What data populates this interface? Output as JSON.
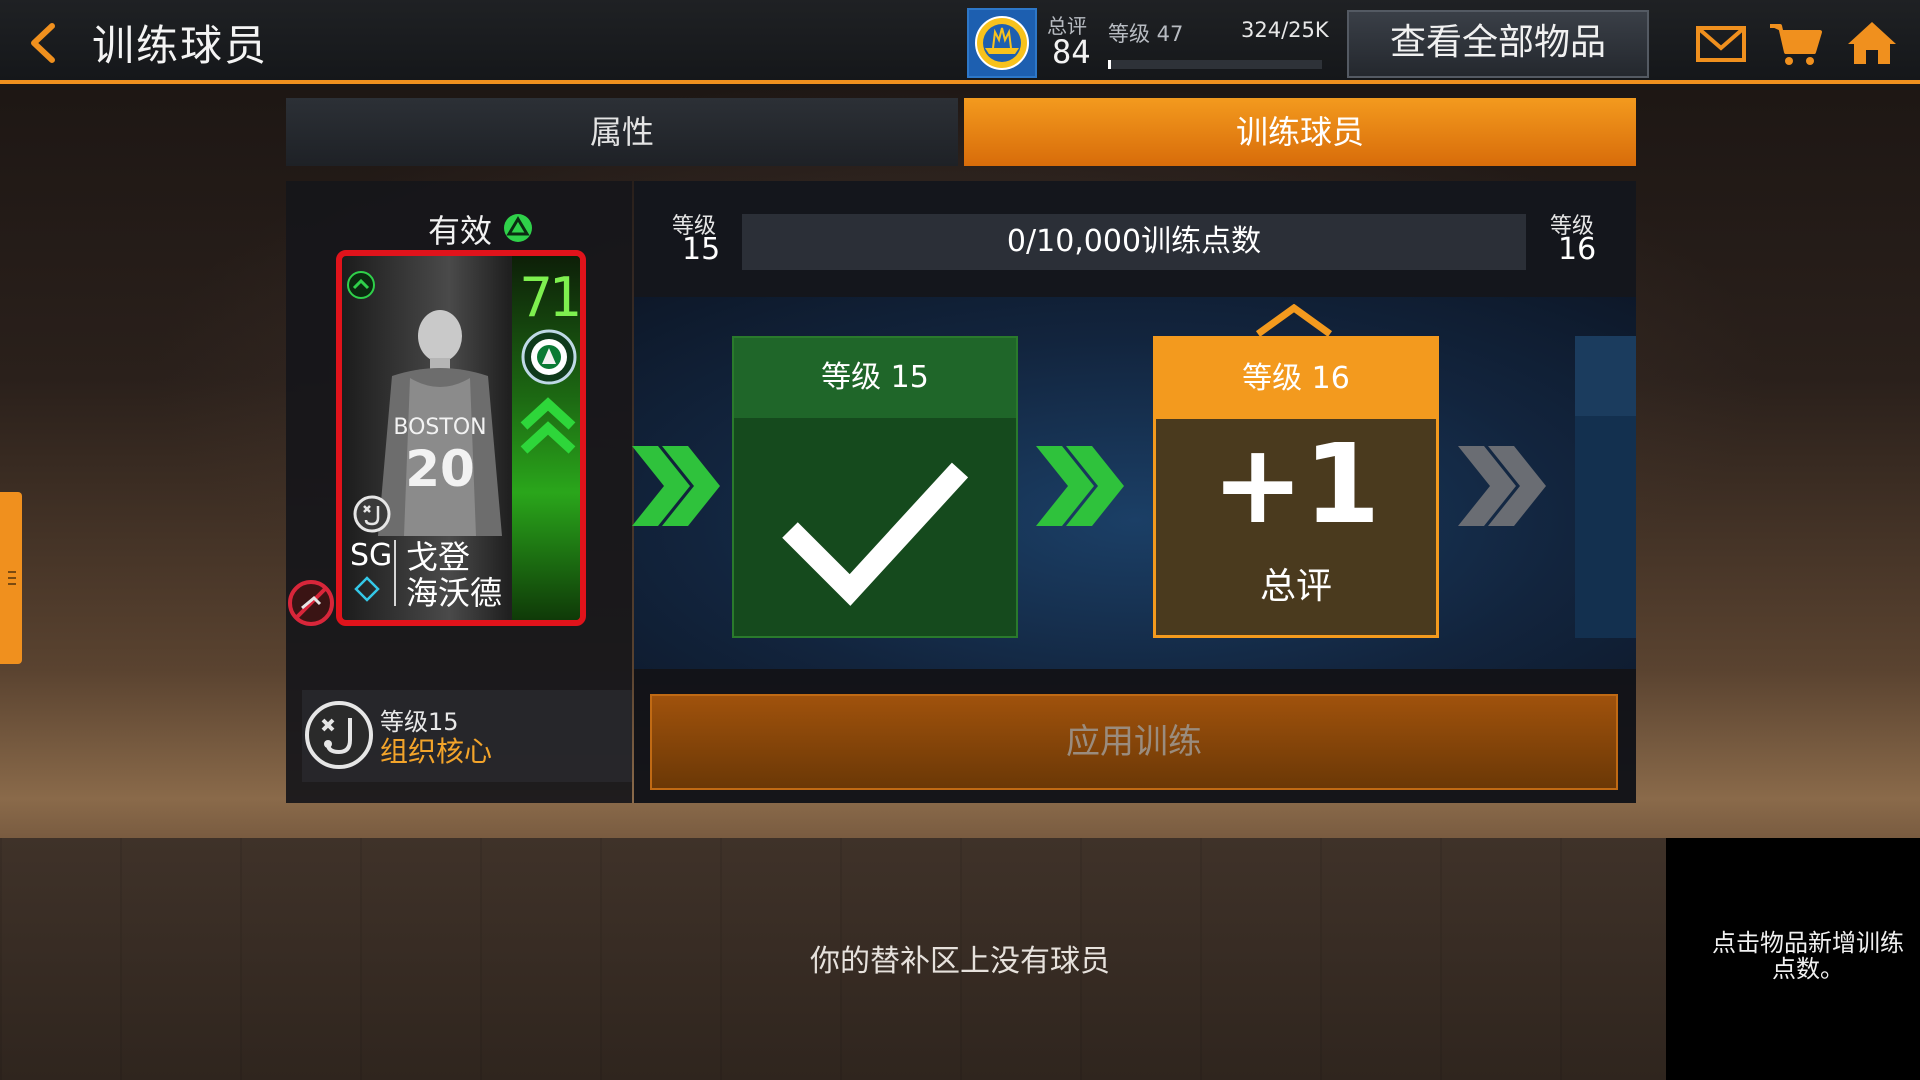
{
  "header": {
    "title": "训练球员",
    "overall_label": "总评",
    "overall_value": "84",
    "level_label": "等级 47",
    "xp_text": "324/25K",
    "xp_progress": 0.013,
    "view_all_label": "查看全部物品",
    "icons": [
      "back-chevron-icon",
      "team-logo-icon",
      "mail-icon",
      "cart-icon",
      "home-icon"
    ]
  },
  "tabs": [
    {
      "label": "属性",
      "active": false
    },
    {
      "label": "训练球员",
      "active": true
    }
  ],
  "player": {
    "status_label": "有效",
    "rating": "71",
    "position": "SG",
    "name_line1": "戈登",
    "name_line2": "海沃德",
    "jersey_number": "20",
    "jersey_team": "BOSTON"
  },
  "skill": {
    "level": "等级15",
    "name": "组织核心"
  },
  "progress": {
    "from_label": "等级",
    "from_value": "15",
    "to_label": "等级",
    "to_value": "16",
    "text": "0/10,000训练点数",
    "fraction": 0
  },
  "rewards": [
    {
      "title": "等级 15",
      "state": "completed"
    },
    {
      "title": "等级 16",
      "value": "+1",
      "label": "总评",
      "state": "current"
    }
  ],
  "apply_button_label": "应用训练",
  "bench": {
    "empty_message": "你的替补区上没有球员",
    "hint": "点击物品新增训练点数。"
  },
  "colors": {
    "accent_orange": "#f39a1e",
    "card_border_red": "#e0131b",
    "rating_green": "#7ef04f",
    "skill_orange": "#f3a42a"
  }
}
